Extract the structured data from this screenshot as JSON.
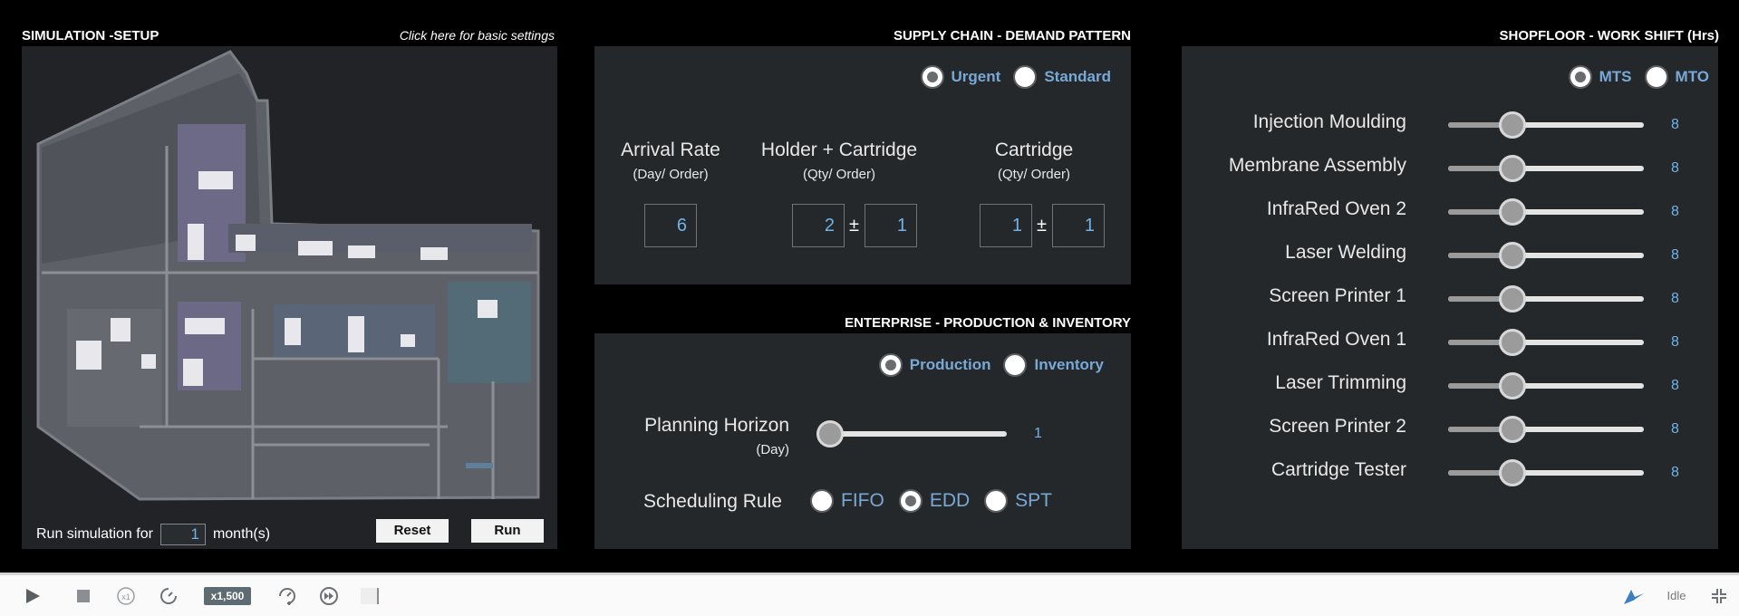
{
  "simulation": {
    "title": "SIMULATION -SETUP",
    "settings_link": "Click here for basic settings",
    "run_prefix": "Run simulation for",
    "run_months": "1",
    "run_suffix": "month(s)",
    "reset_label": "Reset",
    "run_label": "Run"
  },
  "supply_chain": {
    "title": "SUPPLY CHAIN - DEMAND PATTERN",
    "demand_options": [
      {
        "label": "Urgent",
        "checked": true
      },
      {
        "label": "Standard",
        "checked": false
      }
    ],
    "arrival_rate": {
      "title": "Arrival Rate",
      "sub": "(Day/ Order)",
      "value": "6"
    },
    "holder_cartridge": {
      "title": "Holder + Cartridge",
      "sub": "(Qty/ Order)",
      "value": "2",
      "deviation": "1"
    },
    "cartridge": {
      "title": "Cartridge",
      "sub": "(Qty/ Order)",
      "value": "1",
      "deviation": "1"
    },
    "plus_minus": "±"
  },
  "enterprise": {
    "title": "ENTERPRISE - PRODUCTION & INVENTORY",
    "mode_options": [
      {
        "label": "Production",
        "checked": true
      },
      {
        "label": "Inventory",
        "checked": false
      }
    ],
    "planning_horizon": {
      "label": "Planning Horizon",
      "unit": "(Day)",
      "value": "1",
      "fraction": 0.0
    },
    "scheduling_rule": {
      "label": "Scheduling Rule",
      "options": [
        {
          "label": "FIFO",
          "checked": false
        },
        {
          "label": "EDD",
          "checked": true
        },
        {
          "label": "SPT",
          "checked": false
        }
      ]
    }
  },
  "shopfloor": {
    "title": "SHOPFLOOR - WORK SHIFT (Hrs)",
    "mode_options": [
      {
        "label": "MTS",
        "checked": true
      },
      {
        "label": "MTO",
        "checked": false
      }
    ],
    "stations": [
      {
        "label": "Injection Moulding",
        "value": "8",
        "fraction": 0.33
      },
      {
        "label": "Membrane Assembly",
        "value": "8",
        "fraction": 0.33
      },
      {
        "label": "InfraRed Oven 2",
        "value": "8",
        "fraction": 0.33
      },
      {
        "label": "Laser Welding",
        "value": "8",
        "fraction": 0.33
      },
      {
        "label": "Screen Printer 1",
        "value": "8",
        "fraction": 0.33
      },
      {
        "label": "InfraRed Oven 1",
        "value": "8",
        "fraction": 0.33
      },
      {
        "label": "Laser Trimming",
        "value": "8",
        "fraction": 0.33
      },
      {
        "label": "Screen Printer 2",
        "value": "8",
        "fraction": 0.33
      },
      {
        "label": "Cartridge Tester",
        "value": "8",
        "fraction": 0.33
      }
    ]
  },
  "toolbar": {
    "speed": "x1,500",
    "status": "Idle",
    "accent": "#3d7fc1"
  }
}
